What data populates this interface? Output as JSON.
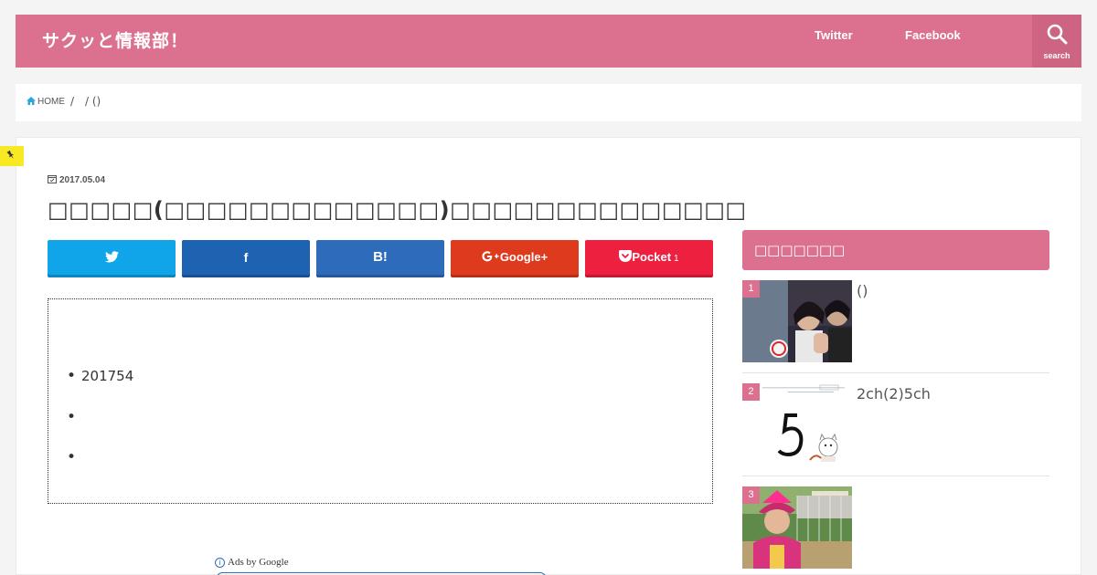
{
  "site": {
    "logo": "サクッと情報部！"
  },
  "nav": {
    "twitter": "Twitter",
    "facebook": "Facebook",
    "search_label": "search"
  },
  "breadcrumb": {
    "home": "HOME",
    "sep": "/",
    "current": "/ ()"
  },
  "post": {
    "date": "2017.05.04",
    "title": "□□□□□(□□□□□□□□□□□□□)□□□□□□□□□□□□□□"
  },
  "share": {
    "twitter_icon": "twitter-icon",
    "facebook_label": "f",
    "hatena_label": "B!",
    "google_label": "Google+",
    "pocket_label": "Pocket",
    "pocket_count": "1"
  },
  "toc": {
    "items": [
      "201754",
      "",
      ""
    ]
  },
  "ads": {
    "info": "i",
    "label": "Ads by Google"
  },
  "sidebar": {
    "ranking_title": "□□□□□□□",
    "items": [
      {
        "rank": "1",
        "text": "()"
      },
      {
        "rank": "2",
        "text": "2ch(2)5ch"
      },
      {
        "rank": "3",
        "text": ""
      }
    ]
  },
  "colors": {
    "brand": "#dc718f",
    "twitter": "#10a4e8",
    "facebook": "#1e62b2",
    "hatena": "#2e6bbb",
    "google": "#de3b1e",
    "pocket": "#ee2040"
  }
}
